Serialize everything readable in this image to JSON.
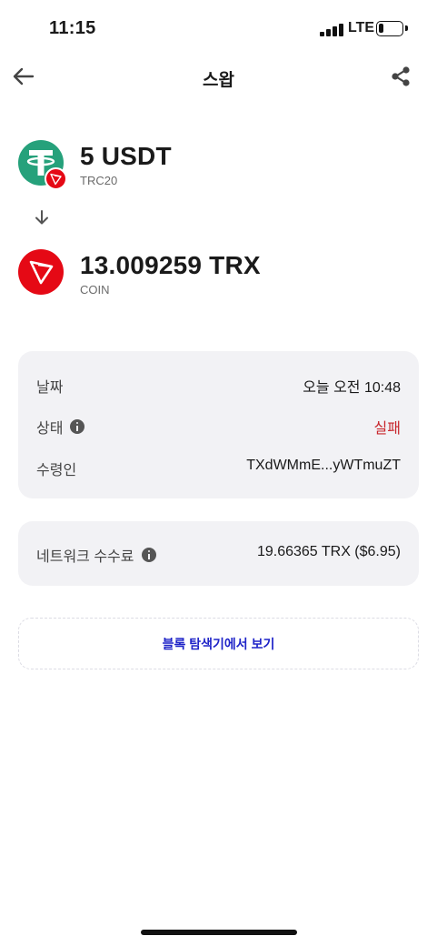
{
  "status_bar": {
    "time": "11:15",
    "network": "LTE",
    "battery_level": 0.2
  },
  "nav": {
    "title": "스왑",
    "back_icon": "arrow-left-icon",
    "share_icon": "share-icon"
  },
  "from_asset": {
    "amount": "5 USDT",
    "network": "TRC20",
    "icon": "usdt-icon",
    "badge_icon": "tron-badge-icon"
  },
  "to_asset": {
    "amount": "13.009259 TRX",
    "network": "COIN",
    "icon": "tron-icon"
  },
  "details": {
    "date_label": "날짜",
    "date_value": "오늘 오전 10:48",
    "status_label": "상태",
    "status_value": "실패",
    "recipient_label": "수령인",
    "recipient_value": "TXdWMmE...yWTmuZT"
  },
  "fee": {
    "label": "네트워크 수수료",
    "value": "19.66365 TRX ($6.95)"
  },
  "explorer": {
    "label": "블록 탐색기에서 보기"
  },
  "colors": {
    "usdt_green": "#26a17b",
    "tron_red": "#e50915",
    "fail_red": "#c8272d",
    "link_blue": "#1f24c8",
    "card_bg": "#f2f2f5"
  }
}
